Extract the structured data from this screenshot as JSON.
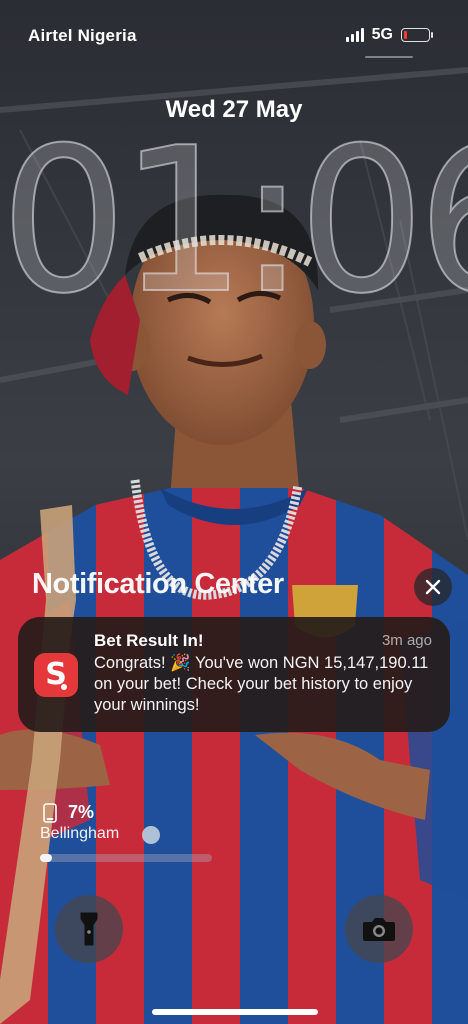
{
  "status_bar": {
    "carrier": "Airtel Nigeria",
    "network": "5G",
    "battery_level": 0.1,
    "signal_bars": 4
  },
  "lockscreen": {
    "date": "Wed 27 May",
    "time": "01:06"
  },
  "notification_center": {
    "title": "Notification Center",
    "close_icon": "close-icon"
  },
  "notification": {
    "app_icon": "sporty-s-icon",
    "title": "Bet Result In!",
    "time": "3m ago",
    "body": "Congrats! 🎉 You've won NGN 15,147,190.11 on your bet! Check your bet history to enjoy your winnings!"
  },
  "battery_widget": {
    "icon": "phone-battery-icon",
    "percent": "7%",
    "device": "Bellingham",
    "device_icon": "emoji-face-icon",
    "level": 0.07
  },
  "quick_actions": {
    "left_icon": "flashlight-icon",
    "right_icon": "camera-icon"
  },
  "colors": {
    "app_red": "#e5383b",
    "jersey_blue": "#1f4e9a",
    "jersey_red": "#c72b3a",
    "battery_low": "#ff3b30"
  }
}
